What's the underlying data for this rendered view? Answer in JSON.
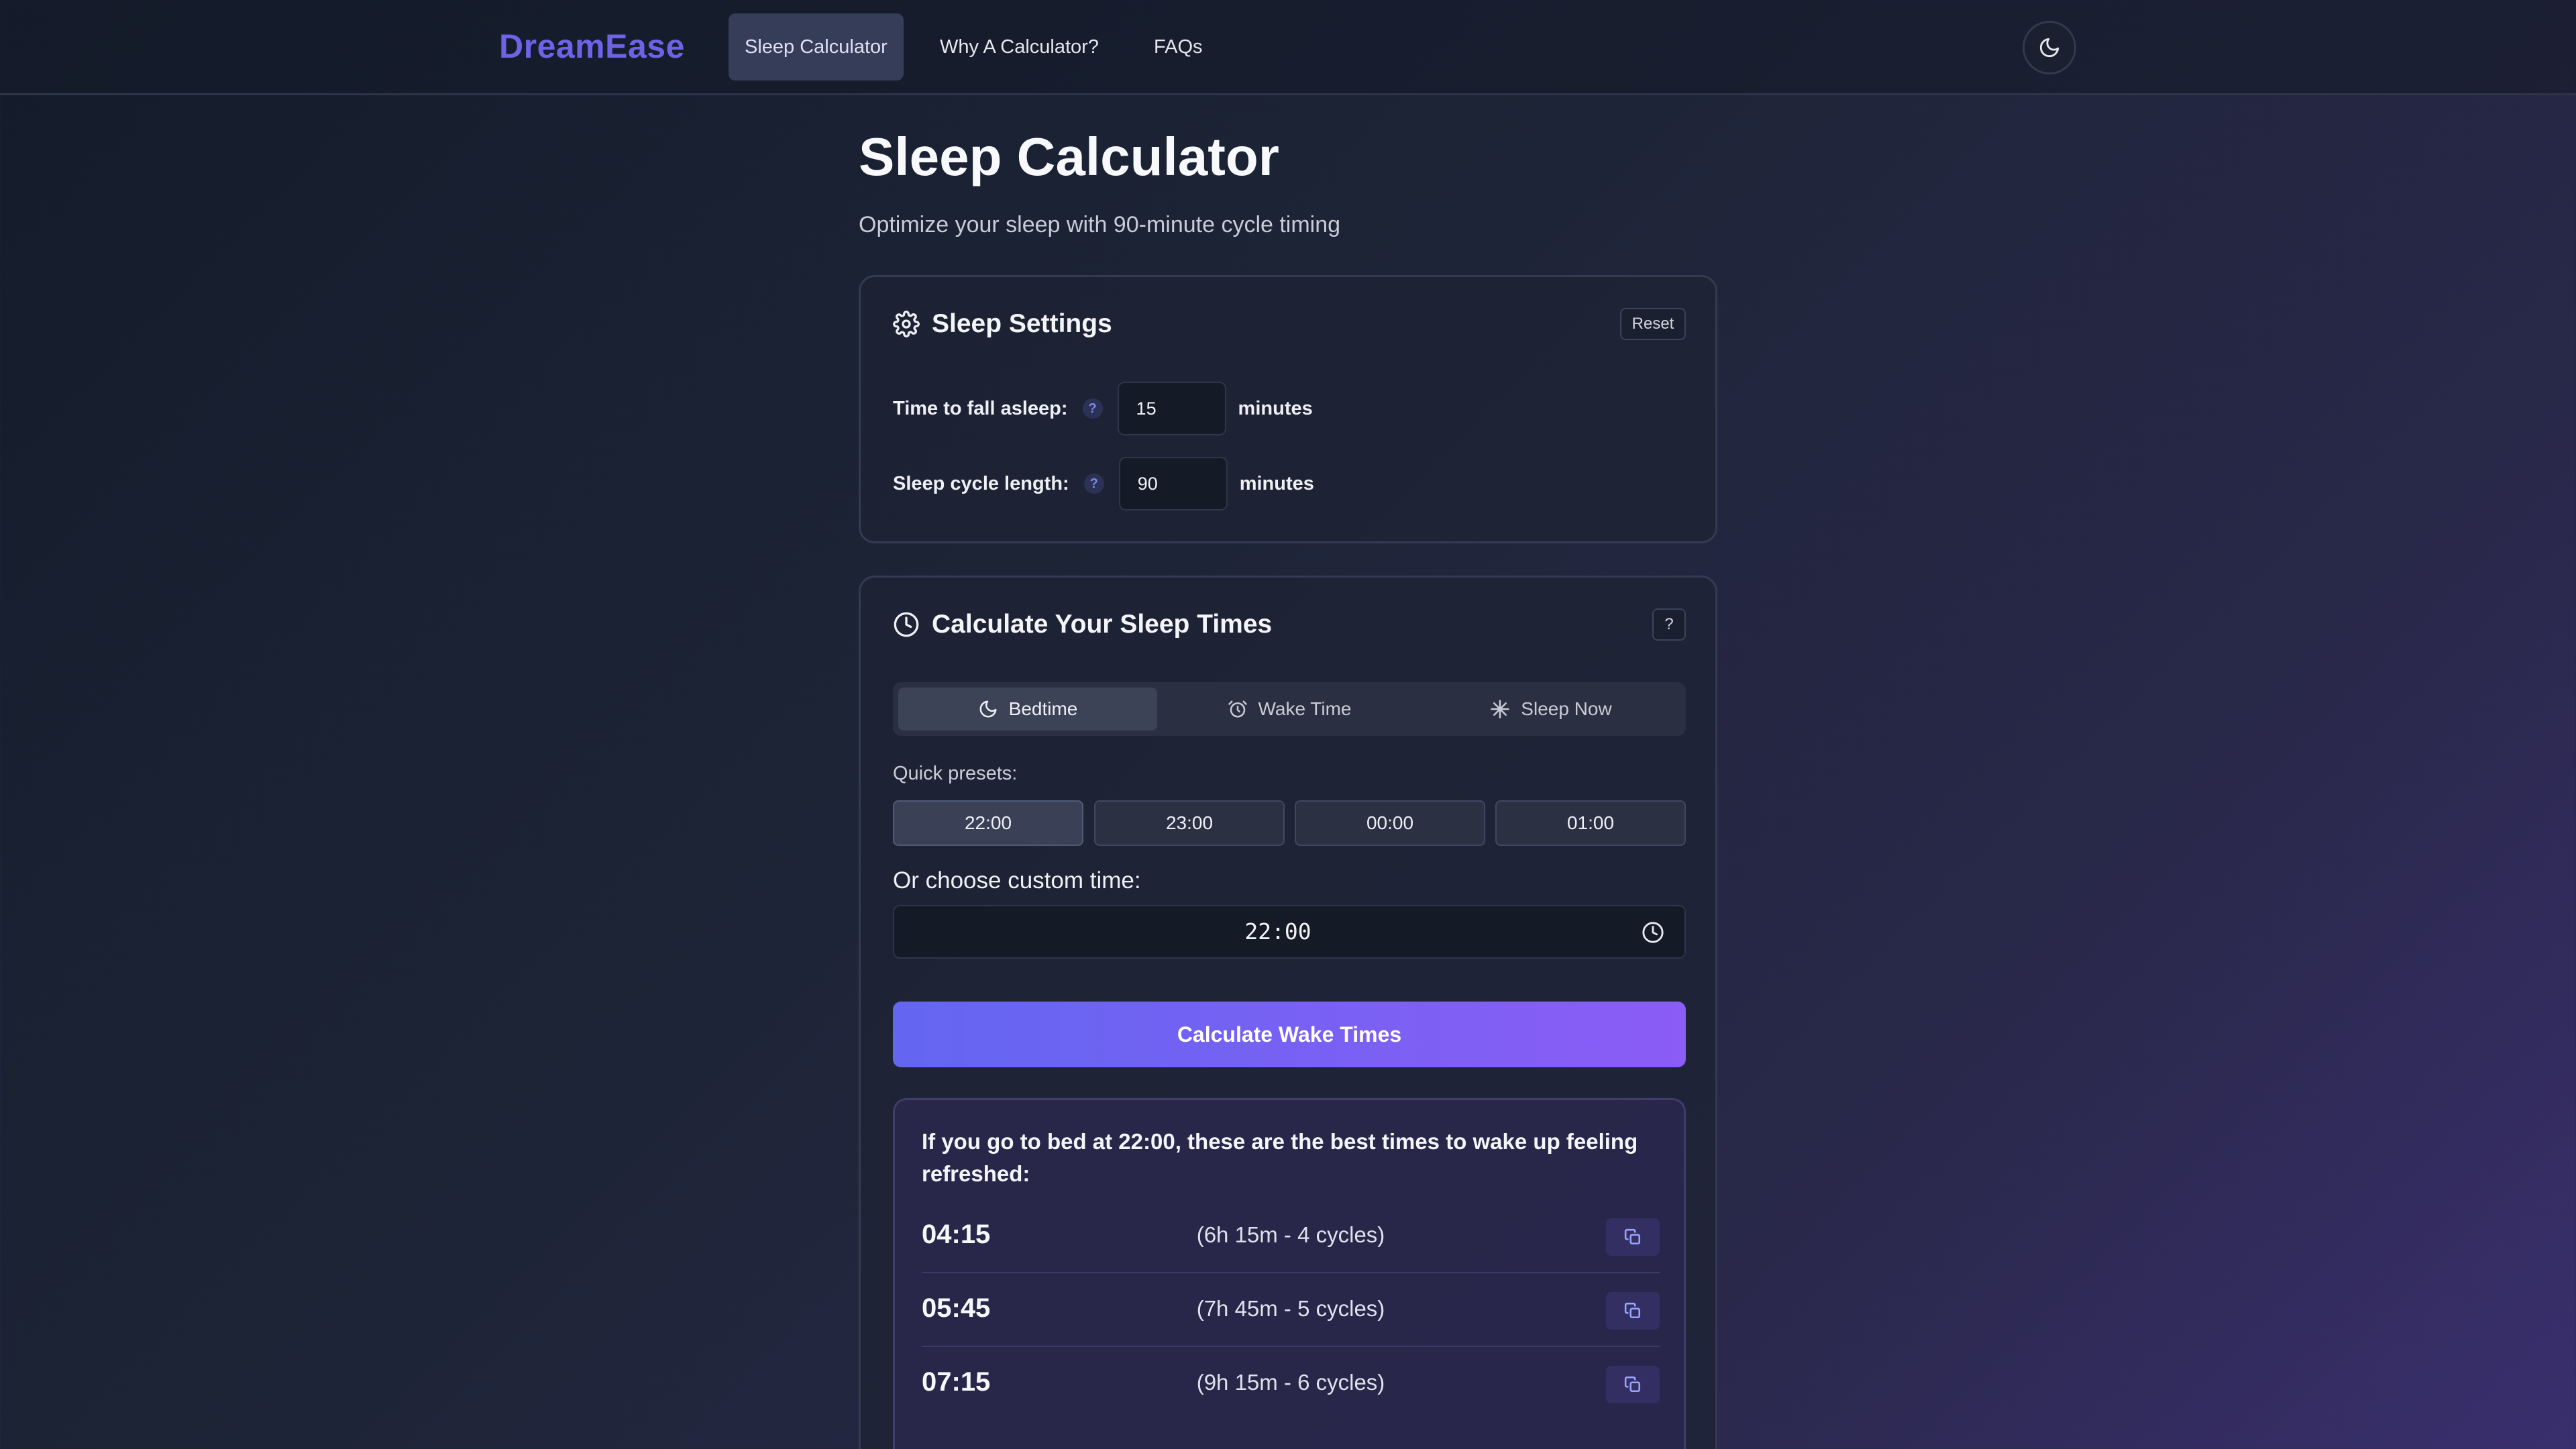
{
  "header": {
    "brand": "DreamEase",
    "nav": [
      {
        "label": "Sleep Calculator",
        "active": true
      },
      {
        "label": "Why A Calculator?",
        "active": false
      },
      {
        "label": "FAQs",
        "active": false
      }
    ],
    "theme_icon": "moon-icon"
  },
  "page": {
    "title": "Sleep Calculator",
    "subtitle": "Optimize your sleep with 90-minute cycle timing"
  },
  "settings": {
    "title": "Sleep Settings",
    "title_icon": "gear-icon",
    "reset_label": "Reset",
    "fall_asleep": {
      "label": "Time to fall asleep:",
      "help": "?",
      "value": "15",
      "unit": "minutes"
    },
    "cycle_length": {
      "label": "Sleep cycle length:",
      "help": "?",
      "value": "90",
      "unit": "minutes"
    }
  },
  "calculator": {
    "title": "Calculate Your Sleep Times",
    "title_icon": "clock-icon",
    "help_label": "?",
    "tabs": [
      {
        "label": "Bedtime",
        "icon": "moon-icon",
        "active": true
      },
      {
        "label": "Wake Time",
        "icon": "alarm-clock-icon",
        "active": false
      },
      {
        "label": "Sleep Now",
        "icon": "sparkle-icon",
        "active": false
      }
    ],
    "presets_label": "Quick presets:",
    "presets": [
      "22:00",
      "23:00",
      "00:00",
      "01:00"
    ],
    "selected_preset": "22:00",
    "custom_label": "Or choose custom time:",
    "custom_time": "22:00",
    "calculate_label": "Calculate Wake Times"
  },
  "results": {
    "title": "If you go to bed at 22:00, these are the best times to wake up feeling refreshed:",
    "rows": [
      {
        "time": "04:15",
        "detail": "(6h 15m - 4 cycles)"
      },
      {
        "time": "05:45",
        "detail": "(7h 45m - 5 cycles)"
      },
      {
        "time": "07:15",
        "detail": "(9h 15m - 6 cycles)"
      }
    ],
    "copy_icon": "copy-icon"
  },
  "colors": {
    "brand": "#6c63e6",
    "accent_start": "#6366f1",
    "accent_end": "#8b5cf6"
  }
}
